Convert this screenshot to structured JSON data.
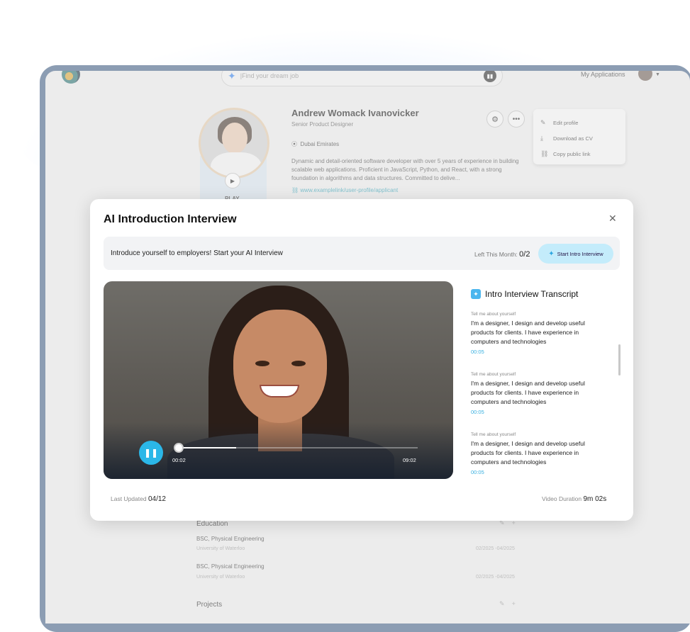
{
  "header": {
    "search_placeholder": "|Find your dream job",
    "my_applications": "My Applications"
  },
  "profile": {
    "name": "Andrew Womack Ivanovicker",
    "role": "Senior Product Designer",
    "location": "Dubai Emirates",
    "bio": "Dynamic and detail-oriented software developer with over 5 years of experience in building scalable web applications. Proficient in JavaScript, Python, and React, with a strong foundation in algorithms and data structures. Committed to delive...",
    "link": "www.examplelink/user-profile/applicant",
    "play_label": "PLAY"
  },
  "profile_menu": {
    "items": [
      "Edit profile",
      "Download as CV",
      "Copy public link"
    ]
  },
  "sections": {
    "education": {
      "title": "Education",
      "entries": [
        {
          "degree": "BSC, Physical Engineering",
          "school": "University of Waterloo",
          "dates": "02/2025 -04/2025"
        },
        {
          "degree": "BSC, Physical Engineering",
          "school": "University of Waterloo",
          "dates": "02/2025 -04/2025"
        }
      ]
    },
    "projects": {
      "title": "Projects"
    }
  },
  "modal": {
    "title": "AI Introduction Interview",
    "banner_text": "Introduce yourself to employers! Start your AI Interview",
    "left_label": "Left This Month: ",
    "left_value": "0/2",
    "start_button": "Start Intro Interview",
    "player": {
      "current": "00:02",
      "duration": "09:02",
      "progress": 0.24
    },
    "transcript_title": "Intro Interview Transcript",
    "transcript": [
      {
        "question": "Tell me about yourself",
        "answer": "I'm a designer, I design and develop useful products for clients. I have experience in computers and technologies",
        "time": "00:05"
      },
      {
        "question": "Tell me about yourself",
        "answer": "I'm a designer, I design and develop useful products for clients. I have experience in computers and technologies",
        "time": "00:05"
      },
      {
        "question": "Tell me about yourself",
        "answer": "I'm a designer, I design and develop useful products for clients. I have experience in computers and technologies",
        "time": "00:05"
      }
    ],
    "last_updated_label": "Last Updated",
    "last_updated_value": "04/12",
    "video_duration_label": "Video Duration",
    "video_duration_value": "9m 02s"
  },
  "colors": {
    "accent": "#2bb7e8",
    "link": "#2a9fb5",
    "frame": "#8c9db3"
  }
}
